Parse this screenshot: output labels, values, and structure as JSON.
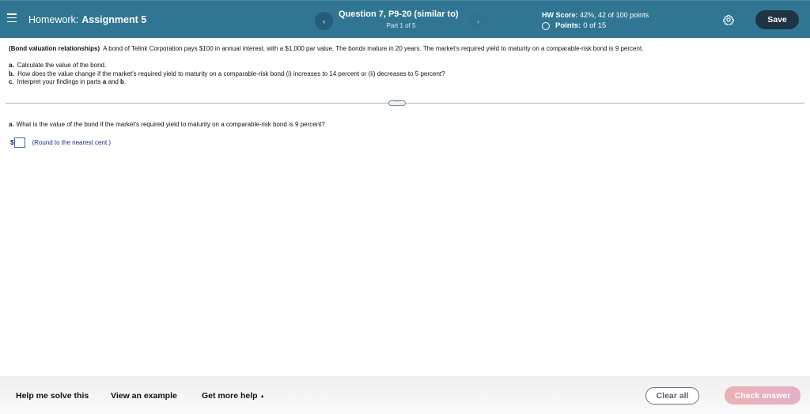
{
  "header": {
    "homework_prefix": "Homework:",
    "assignment_name": "Assignment 5",
    "question_title": "Question 7, P9-20 (similar to)",
    "question_part": "Part 1 of 5",
    "prev_icon": "‹",
    "next_icon": "›",
    "hw_score_label": "HW Score:",
    "hw_score_value": "42%, 42 of 100 points",
    "points_label": "Points:",
    "points_value": "0 of 15",
    "save_label": "Save"
  },
  "problem": {
    "topic": "(Bond valuation relationships)",
    "statement": "A bond of Telink Corporation pays $100 in annual interest, with a $1,000 par value.  The bonds mature in 20 years.  The market's required yield to maturity on a comparable-risk bond is 9 percent.",
    "parts": [
      {
        "label": "a.",
        "text": "Calculate the value of the bond."
      },
      {
        "label": "b.",
        "text": "How does the value change if the market's required yield to maturity on a comparable-risk bond (i) increases to 14 percent or (ii) decreases to 5 percent?"
      },
      {
        "label": "c.",
        "text_before": "Interpret your findings in parts",
        "bold_a": "a",
        "text_and": "and",
        "bold_b": "b",
        "text_end": "."
      }
    ]
  },
  "divider": {
    "more_label": "···"
  },
  "question": {
    "label": "a.",
    "text": "What is the value of the bond if the market's required yield to maturity on a comparable-risk bond is 9 percent?",
    "currency": "$",
    "answer_value": "",
    "hint": "(Round to the nearest cent.)"
  },
  "footer": {
    "help_me_solve": "Help me solve this",
    "view_example": "View an example",
    "get_more_help": "Get more help",
    "get_more_help_caret": "▲",
    "clear_all": "Clear all",
    "check_answer": "Check answer"
  },
  "colors": {
    "header_bg": "#307693",
    "save_bg": "#1e3445",
    "check_answer_bg": "#e8b0bd",
    "input_border": "#2b6cc4",
    "hint_text": "#1a2a8a"
  }
}
